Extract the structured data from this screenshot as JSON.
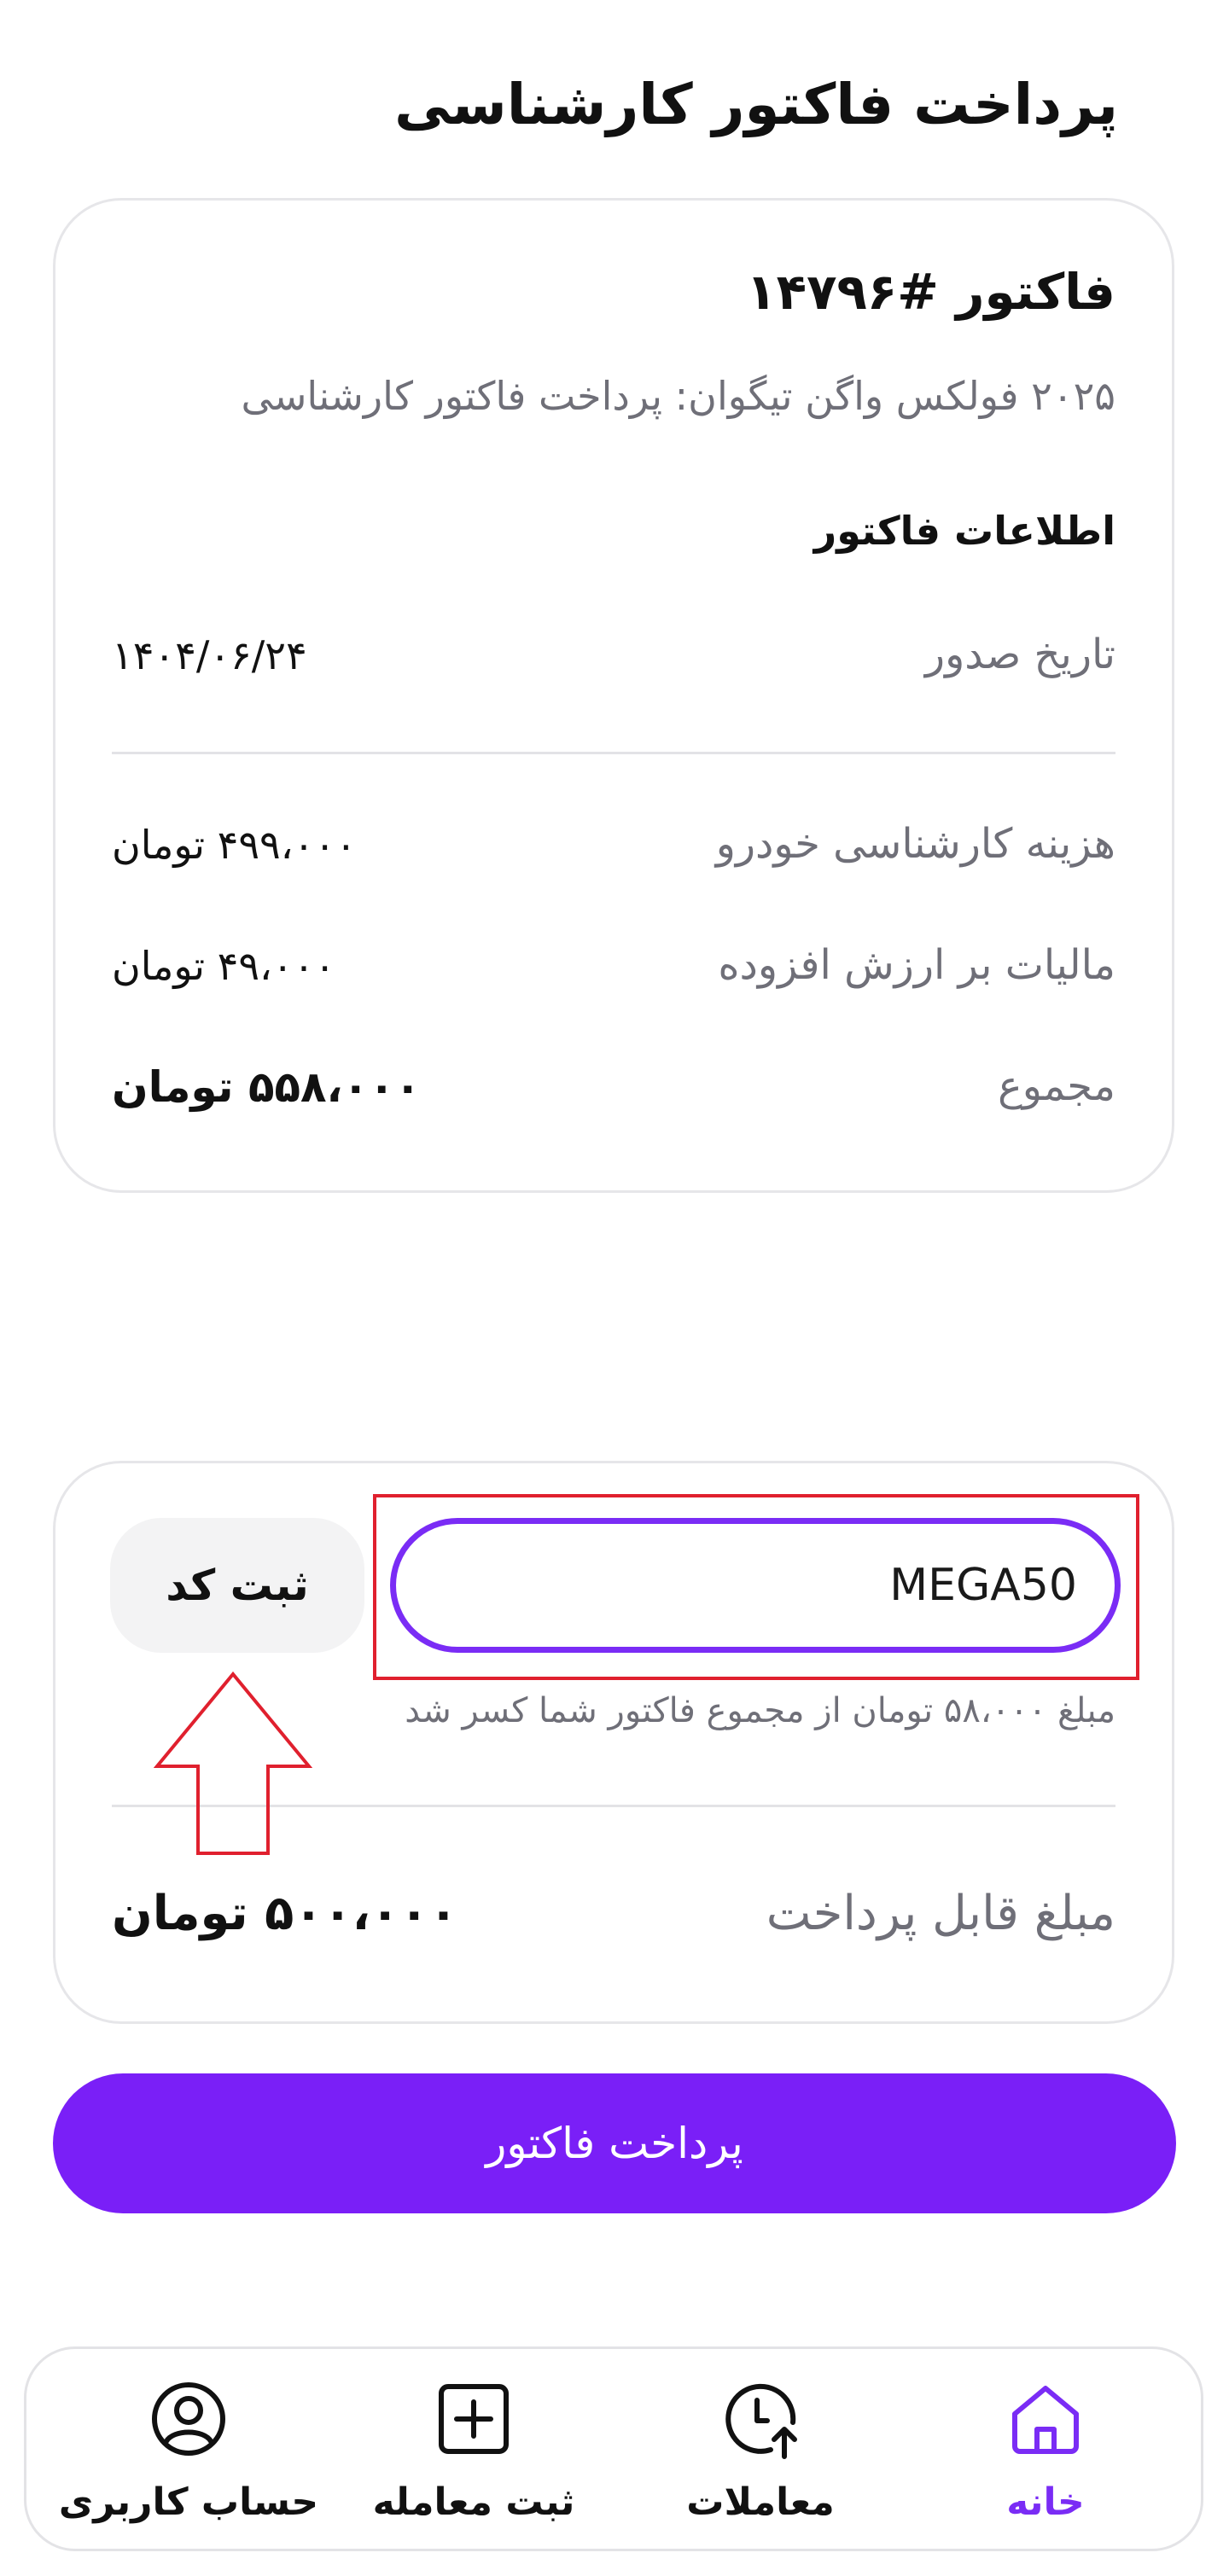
{
  "page": {
    "title": "پرداخت فاکتور کارشناسی"
  },
  "invoice": {
    "number_label": "فاکتور #۱۴۷۹۶",
    "description": "۲۰۲۵ فولکس واگن تیگوان: پرداخت فاکتور کارشناسی",
    "section_title": "اطلاعات فاکتور",
    "issue_date_label": "تاریخ صدور",
    "issue_date_value": "۱۴۰۴/۰۶/۲۴",
    "items": [
      {
        "label": "هزینه کارشناسی خودرو",
        "value": "۴۹۹،۰۰۰ تومان"
      },
      {
        "label": "مالیات بر ارزش افزوده",
        "value": "۴۹،۰۰۰ تومان"
      }
    ],
    "total_label": "مجموع",
    "total_value": "۵۵۸،۰۰۰ تومان"
  },
  "discount": {
    "code_value": "MEGA50",
    "apply_label": "ثبت کد",
    "note": "مبلغ ۵۸،۰۰۰ تومان از مجموع فاکتور شما کسر شد",
    "payable_label": "مبلغ قابل پرداخت",
    "payable_value": "۵۰۰،۰۰۰ تومان"
  },
  "pay_button_label": "پرداخت فاکتور",
  "bottom_nav": {
    "items": [
      {
        "label": "خانه",
        "icon": "home-icon",
        "active": true
      },
      {
        "label": "معاملات",
        "icon": "clock-arrow-icon",
        "active": false
      },
      {
        "label": "ثبت معامله",
        "icon": "plus-square-icon",
        "active": false
      },
      {
        "label": "حساب کاربری",
        "icon": "user-circle-icon",
        "active": false
      }
    ]
  },
  "colors": {
    "accent": "#7a2cf5",
    "pay_button": "#7a1ff7",
    "annotation": "#e0202e",
    "muted_text": "#6f6f78",
    "border": "#e6e6e9"
  }
}
